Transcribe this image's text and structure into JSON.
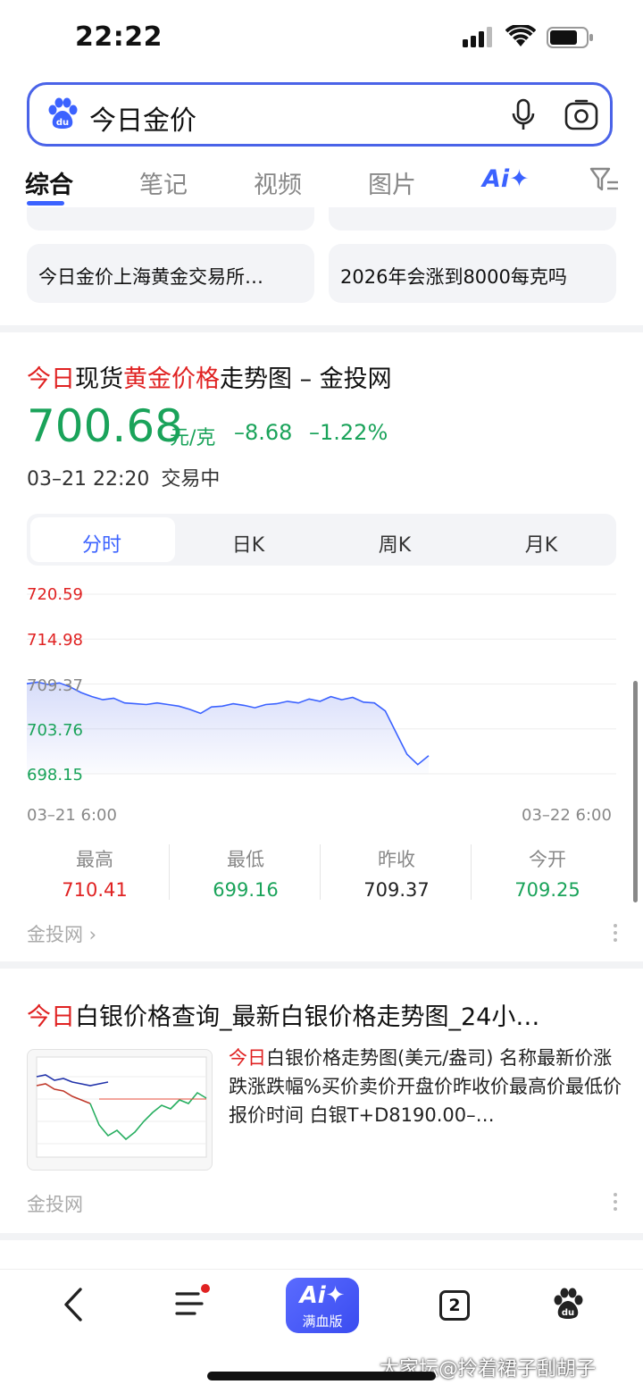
{
  "status_bar": {
    "time": "22:22"
  },
  "search": {
    "query": "今日金价"
  },
  "tabs": [
    {
      "label": "综合"
    },
    {
      "label": "笔记"
    },
    {
      "label": "视频"
    },
    {
      "label": "图片"
    },
    {
      "label": "Ai✦"
    }
  ],
  "suggestions": [
    "今日金价上海黄金交易所…",
    "2026年会涨到8000每克吗"
  ],
  "gold_card": {
    "title_parts": [
      "今日",
      "现货",
      "黄金价格",
      "走势图 – 金投网"
    ],
    "price": "700.68",
    "unit": "元/克",
    "change": "–8.68",
    "change_pct": "–1.22%",
    "time": "03–21 22:20",
    "trade_status": "交易中",
    "segments": [
      "分时",
      "日K",
      "周K",
      "月K"
    ],
    "active_segment": 0,
    "y_ticks": [
      "720.59",
      "714.98",
      "709.37",
      "703.76",
      "698.15"
    ],
    "x_start": "03–21 6:00",
    "x_end": "03–22 6:00",
    "stats": [
      {
        "label": "最高",
        "value": "710.41"
      },
      {
        "label": "最低",
        "value": "699.16"
      },
      {
        "label": "昨收",
        "value": "709.37"
      },
      {
        "label": "今开",
        "value": "709.25"
      }
    ],
    "source": "金投网 ›"
  },
  "chart_data": {
    "type": "area",
    "ylim": [
      698.15,
      720.59
    ],
    "y_ticks": [
      720.59,
      714.98,
      709.37,
      703.76,
      698.15
    ],
    "x_range": [
      "03-21 6:00",
      "03-22 6:00"
    ],
    "series": [
      {
        "values": [
          709.4,
          709.6,
          709.3,
          709.5,
          709.0,
          708.3,
          707.8,
          707.4,
          707.6,
          707.0,
          706.9,
          706.8,
          707.0,
          706.8,
          706.6,
          706.2,
          705.7,
          706.5,
          706.6,
          706.9,
          706.7,
          706.4,
          706.8,
          706.9,
          707.2,
          707.0,
          707.5,
          707.2,
          707.8,
          707.4,
          707.7,
          707.1,
          707.0,
          706.0,
          703.3,
          700.6,
          699.3,
          700.4
        ]
      }
    ]
  },
  "silver_card": {
    "title_red": "今日",
    "title_rest": "白银价格查询_最新白银价格走势图_24小…",
    "desc_red": "今日",
    "desc_rest": "白银价格走势图(美元/盎司) 名称最新价涨跌涨跌幅%买价卖价开盘价昨收价最高价最低价报价时间 白银T+D8190.00–…",
    "source": "金投网"
  },
  "bottom_bar": {
    "ai_label": "Ai✦",
    "ai_sub": "满血版",
    "tab_count": "2"
  },
  "watermark": "大家坛@拎着裙子刮胡子"
}
